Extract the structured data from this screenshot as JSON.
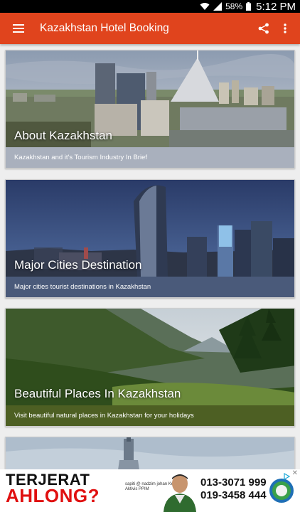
{
  "status_bar": {
    "battery": "58%",
    "time": "5:12 PM"
  },
  "app_bar": {
    "title": "Kazakhstan Hotel Booking",
    "menu_icon": "hamburger-menu-icon",
    "share_icon": "share-icon",
    "overflow_icon": "more-vertical-icon",
    "color": "#e0441d"
  },
  "cards": [
    {
      "title": "About Kazakhstan",
      "caption": "Kazakhstan and it's Tourism Industry In Brief"
    },
    {
      "title": "Major Cities Destination",
      "caption": "Major cities tourist destinations in Kazakhstan"
    },
    {
      "title": "Beautiful Places In Kazakhstan",
      "caption": "Visit beautiful natural places in Kazakhstan for your holidays"
    }
  ],
  "ad": {
    "headline_line1": "TERJERAT",
    "headline_line2": "AHLONG?",
    "small_text": "sapiti @ nadzim johan Kesra Aktivis PPIM",
    "phone1": "013-3071 999",
    "phone2": "019-3458 444",
    "adchoices_icon": "adchoices-icon",
    "close_icon": "close-icon"
  }
}
